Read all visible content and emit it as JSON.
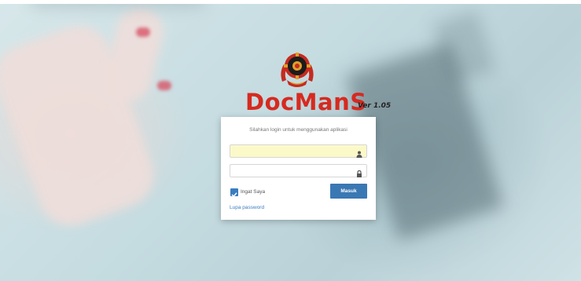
{
  "app": {
    "brand": "DocManS",
    "version": "Ver 1.05"
  },
  "login": {
    "message": "Silahkan login untuk menggunakan aplikasi",
    "username": {
      "value": "",
      "placeholder": "",
      "icon": "user-icon"
    },
    "password": {
      "value": "",
      "placeholder": "",
      "icon": "lock-icon"
    },
    "remember": {
      "label": "Ingat Saya",
      "checked": true
    },
    "submit_label": "Masuk",
    "forgot_label": "Lupa password"
  },
  "colors": {
    "brand": "#d62a20",
    "primary": "#3a78b4",
    "autofill": "#fbf9c8"
  }
}
